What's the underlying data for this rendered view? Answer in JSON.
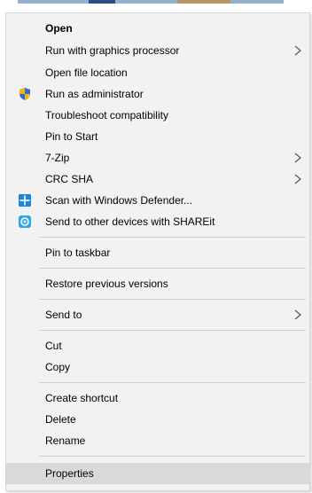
{
  "menu": {
    "open": "Open",
    "run_gpu": "Run with graphics processor",
    "open_location": "Open file location",
    "run_admin": "Run as administrator",
    "troubleshoot": "Troubleshoot compatibility",
    "pin_start": "Pin to Start",
    "zip": "7-Zip",
    "crc": "CRC SHA",
    "defender": "Scan with Windows Defender...",
    "shareit": "Send to other devices with SHAREit",
    "pin_taskbar": "Pin to taskbar",
    "restore": "Restore previous versions",
    "send_to": "Send to",
    "cut": "Cut",
    "copy": "Copy",
    "create_shortcut": "Create shortcut",
    "delete": "Delete",
    "rename": "Rename",
    "properties": "Properties"
  },
  "icons": {
    "admin": "uac-shield-icon",
    "defender": "windows-defender-icon",
    "shareit": "shareit-icon",
    "submenu": "chevron-right-icon"
  },
  "colors": {
    "menu_background": "#f2f2f2",
    "highlight": "#d9d9d9",
    "separator": "#cfcfcf",
    "shield_blue": "#2f6fc4",
    "shield_yellow": "#f2b51c",
    "defender_blue": "#1e84d6",
    "shareit_blue": "#29a8e6"
  }
}
